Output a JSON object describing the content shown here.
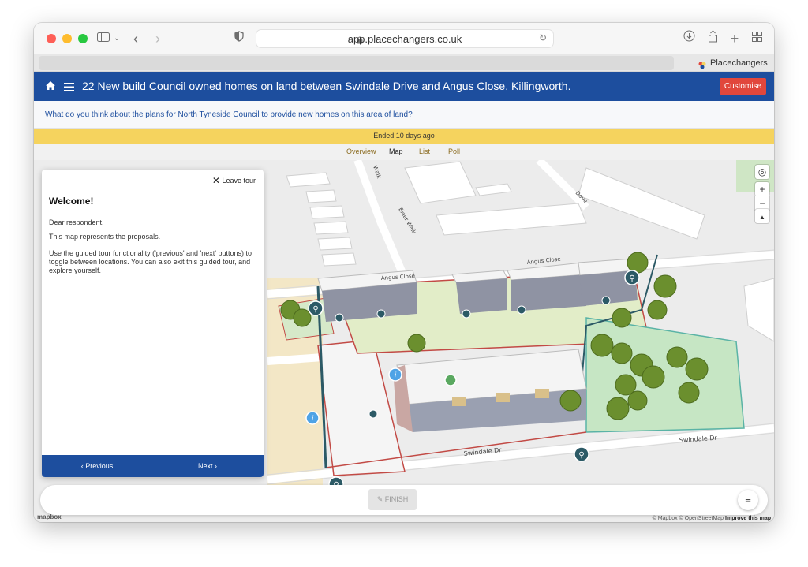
{
  "browser": {
    "url": "app.placechangers.co.uk",
    "tab_title": "Placechangers",
    "colors": {
      "close": "#fe5f57",
      "minimize": "#febc2e",
      "zoom": "#28c840"
    }
  },
  "header": {
    "title": "22 New build Council owned homes on land between Swindale Drive and Angus Close, Killingworth.",
    "customise_label": "Customise",
    "accent": "#1d4e9e"
  },
  "question": "What do you think about the plans for North Tyneside Council to provide new homes on this area of land?",
  "status": "Ended 10 days ago",
  "tabs": [
    "Overview",
    "Map",
    "List",
    "Poll"
  ],
  "active_tab": "Map",
  "tour": {
    "leave_label": "Leave tour",
    "heading": "Welcome!",
    "paragraphs": [
      "Dear respondent,",
      "This map represents the proposals.",
      "Use the guided tour functionality ('previous' and 'next' buttons) to toggle between locations. You can also exit this guided tour, and explore yourself."
    ],
    "previous_label": "Previous",
    "next_label": "Next"
  },
  "map": {
    "street_labels": [
      "Angus Close",
      "Angus Close",
      "Swindale Dr",
      "Swindale Dr",
      "Elder Walk",
      "Dove",
      "Walk"
    ],
    "controls": [
      "locate-icon",
      "zoom-in-icon",
      "zoom-out-icon",
      "compass-icon"
    ],
    "attribution": "© Mapbox © OpenStreetMap",
    "improve_label": "Improve this map",
    "logo": "mapbox"
  },
  "footer": {
    "finish_label": "FINISH"
  }
}
